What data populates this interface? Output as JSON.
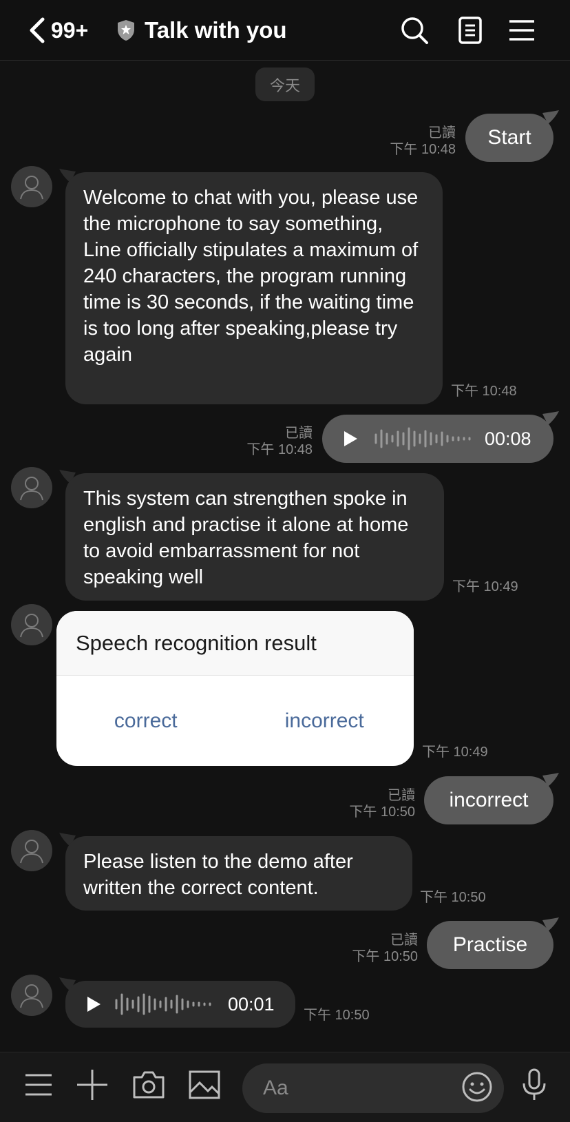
{
  "header": {
    "unread_count": "99+",
    "title": "Talk with you"
  },
  "date_divider": "今天",
  "messages": [
    {
      "side": "out",
      "text": "Start",
      "read": "已讀",
      "time": "下午 10:48"
    },
    {
      "side": "in",
      "text": "Welcome to chat with you, please use the microphone to say something, Line officially stipulates a maximum of 240 characters, the program running time is 30 seconds, if the waiting time is too long after speaking,please try again",
      "time": "下午 10:48"
    },
    {
      "side": "out",
      "type": "voice",
      "duration": "00:08",
      "read": "已讀",
      "time": "下午 10:48"
    },
    {
      "side": "in",
      "text": "This system can strengthen spoke in english and practise it alone at home to avoid embarrassment for not speaking well",
      "time": "下午 10:49"
    },
    {
      "side": "in",
      "type": "card",
      "title": "Speech recognition result",
      "buttons": [
        "correct",
        "incorrect"
      ],
      "time": "下午 10:49"
    },
    {
      "side": "out",
      "text": "incorrect",
      "read": "已讀",
      "time": "下午 10:50"
    },
    {
      "side": "in",
      "text": "Please listen to the demo after written the correct content.",
      "time": "下午 10:50"
    },
    {
      "side": "out",
      "text": "Practise",
      "read": "已讀",
      "time": "下午 10:50"
    },
    {
      "side": "in",
      "type": "voice",
      "duration": "00:01",
      "time": "下午 10:50"
    }
  ],
  "input": {
    "placeholder": "Aa"
  },
  "icons": {
    "header": [
      "back-chevron-icon",
      "shield-star-icon",
      "search-icon",
      "notes-icon",
      "menu-icon"
    ],
    "bottom": [
      "menu-icon",
      "plus-icon",
      "camera-icon",
      "image-icon",
      "emoji-icon",
      "microphone-icon"
    ],
    "avatar": "default-user-avatar"
  },
  "colors": {
    "background": "#121212",
    "incoming_bubble": "#2c2c2c",
    "outgoing_bubble": "#5a5a5a",
    "card_link": "#4a6a9a",
    "meta_text": "#8a8a8a"
  }
}
